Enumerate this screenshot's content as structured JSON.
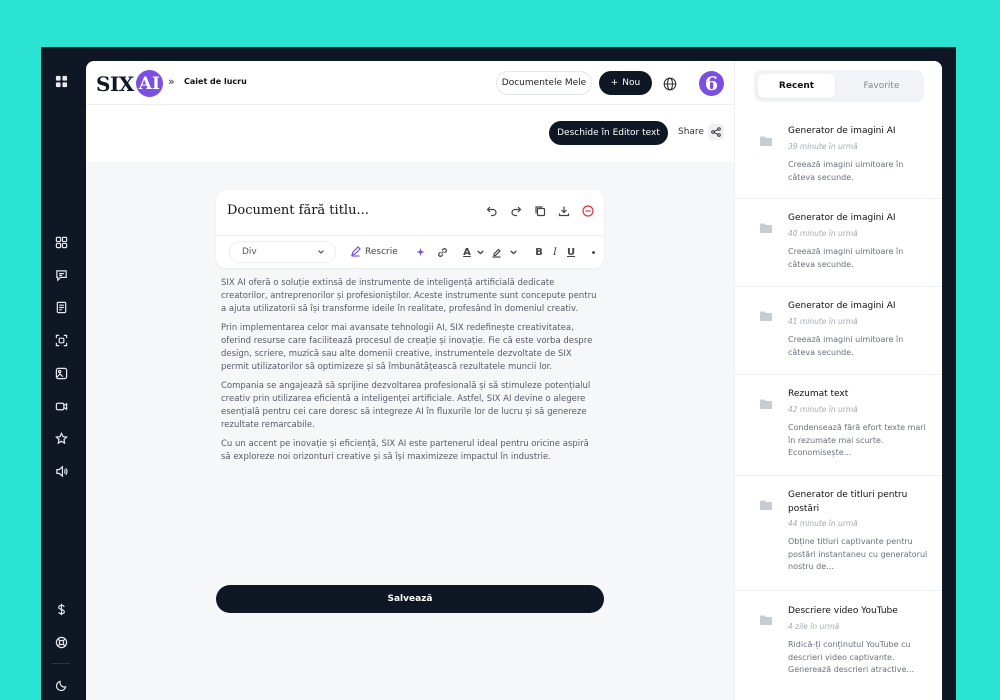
{
  "app": {
    "logo_six": "SIX",
    "logo_ai": "AI",
    "breadcrumb_sep": "»",
    "breadcrumb": "Caiet de lucru"
  },
  "header": {
    "docs_label": "Documentele Mele",
    "new_label": "Nou",
    "avatar_text": "6"
  },
  "subbar": {
    "editor_label": "Deschide în Editor text",
    "share_label": "Share"
  },
  "document": {
    "title": "Document fără titlu...",
    "format_value": "Div",
    "rewrite_label": "Rescrie",
    "paragraphs": [
      "SIX AI oferă o soluție extinsă de instrumente de inteligență artificială dedicate creatorilor, antreprenorilor și profesioniștilor. Aceste instrumente sunt concepute pentru a ajuta utilizatorii să își transforme ideile în realitate, profesând în domeniul creativ.",
      "Prin implementarea celor mai avansate tehnologii AI, SIX redefinește creativitatea, oferind resurse care facilitează procesul de creație și inovație. Fie că este vorba despre design, scriere, muzică sau alte domenii creative, instrumentele dezvoltate de SIX permit utilizatorilor să optimizeze și să îmbunătățească rezultatele muncii lor.",
      "Compania se angajează să sprijine dezvoltarea profesională și să stimuleze potențialul creativ prin utilizarea eficientă a inteligenței artificiale. Astfel, SIX AI devine o alegere esențială pentru cei care doresc să integreze AI în fluxurile lor de lucru și să genereze rezultate remarcabile.",
      "Cu un accent pe inovație și eficiență, SIX AI este partenerul ideal pentru oricine aspiră să exploreze noi orizonturi creative și să își maximizeze impactul în industrie."
    ],
    "save_label": "Salvează"
  },
  "sidebar": {
    "tab_recent": "Recent",
    "tab_favorites": "Favorite",
    "items": [
      {
        "title": "Generator de imagini AI",
        "time": "39 minute în urmă",
        "desc": "Creează imagini uimitoare în câteva secunde."
      },
      {
        "title": "Generator de imagini AI",
        "time": "40 minute în urmă",
        "desc": "Creează imagini uimitoare în câteva secunde."
      },
      {
        "title": "Generator de imagini AI",
        "time": "41 minute în urmă",
        "desc": "Creează imagini uimitoare în câteva secunde."
      },
      {
        "title": "Rezumat text",
        "time": "42 minute în urmă",
        "desc": "Condensează fără efort texte mari în rezumate mai scurte. Economisește..."
      },
      {
        "title": "Generator de titluri pentru postări",
        "time": "44 minute în urmă",
        "desc": "Obține titluri captivante pentru postări instantaneu cu generatorul nostru de..."
      },
      {
        "title": "Descriere video YouTube",
        "time": "4 zile în urmă",
        "desc": "Ridică-ți conținutul YouTube cu descrieri video captivante. Generează descrieri atractive..."
      }
    ]
  },
  "colors": {
    "background": "#2be3d3",
    "frame": "#0f1624",
    "accent": "#7b4fe0",
    "danger": "#e0313c"
  },
  "icons": {
    "rail": [
      "grid-icon",
      "apps-icon",
      "chat-icon",
      "document-icon",
      "scan-icon",
      "image-edit-icon",
      "video-icon",
      "star-icon",
      "speaker-icon",
      "dollar-icon",
      "support-icon",
      "moon-icon"
    ]
  }
}
